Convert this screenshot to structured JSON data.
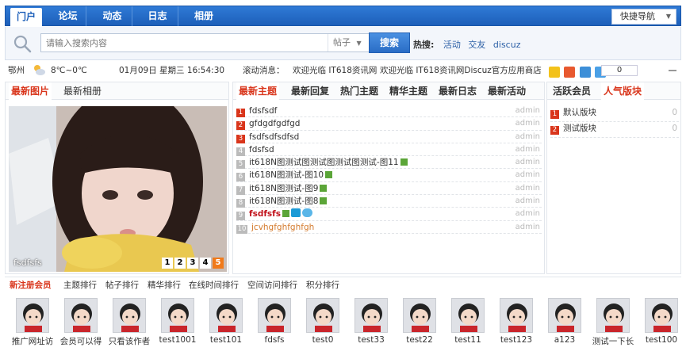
{
  "nav": {
    "tabs": [
      {
        "label": "门户",
        "active": true
      },
      {
        "label": "论坛"
      },
      {
        "label": "动态"
      },
      {
        "label": "日志"
      },
      {
        "label": "相册"
      }
    ],
    "quick_nav": "快捷导航"
  },
  "search": {
    "placeholder": "请输入搜索内容",
    "type": "帖子",
    "button": "搜索",
    "hot_label": "热搜:",
    "hot_terms": [
      "活动",
      "交友",
      "discuz"
    ]
  },
  "status": {
    "city": "鄂州",
    "weather": "8℃~0℃",
    "datetime": "01月09日 星期三 16:54:30",
    "scroll_label": "滚动消息：",
    "msg1": "欢迎光临 IT618资讯网",
    "msg2": "欢迎光临 IT618资讯网Discuz官方应用商店",
    "counter": "0"
  },
  "left_panel": {
    "tabs": [
      "最新图片",
      "最新相册"
    ],
    "photo_caption": "fsdfsfs",
    "pages": [
      "1",
      "2",
      "3",
      "4",
      "5"
    ],
    "current_page": "5"
  },
  "mid_panel": {
    "tabs": [
      "最新主题",
      "最新回复",
      "热门主题",
      "精华主题",
      "最新日志",
      "最新活动"
    ],
    "threads": [
      {
        "num": "1",
        "title": "fdsfsdf",
        "author": "admin"
      },
      {
        "num": "2",
        "title": "gfdgdfgdfgd",
        "author": "admin"
      },
      {
        "num": "3",
        "title": "fsdfsdfsdfsd",
        "author": "admin"
      },
      {
        "num": "4",
        "title": "fdsfsd",
        "author": "admin"
      },
      {
        "num": "5",
        "title": "it618N图测试图测试图测试图测试-图11",
        "author": "admin"
      },
      {
        "num": "6",
        "title": "it618N图测试-图10",
        "author": "admin"
      },
      {
        "num": "7",
        "title": "it618N图测试-图9",
        "author": "admin"
      },
      {
        "num": "8",
        "title": "it618N图测试-图8",
        "author": "admin"
      },
      {
        "num": "9",
        "title": "fsdfsfs",
        "author": "admin"
      },
      {
        "num": "10",
        "title": "jcvhgfghfghfgh",
        "author": "admin"
      }
    ]
  },
  "right_panel": {
    "tabs": [
      "活跃会员",
      "人气版块"
    ],
    "forums": [
      {
        "num": "1",
        "name": "默认版块",
        "count": "0"
      },
      {
        "num": "2",
        "name": "测试版块",
        "count": "0"
      }
    ]
  },
  "members": {
    "tabs": [
      "新注册会员",
      "主题排行",
      "帖子排行",
      "精华排行",
      "在线时间排行",
      "空间访问排行",
      "积分排行"
    ],
    "users": [
      "推广网址访",
      "会员可以得",
      "只看该作者",
      "test1001",
      "test101",
      "fdsfs",
      "test0",
      "test33",
      "test22",
      "test11",
      "test123",
      "a123",
      "测试一下长",
      "test100"
    ]
  },
  "colors": {
    "nav_blue": "#1d5fb9",
    "accent_red": "#d9351b",
    "link_blue": "#2b5fa6"
  }
}
